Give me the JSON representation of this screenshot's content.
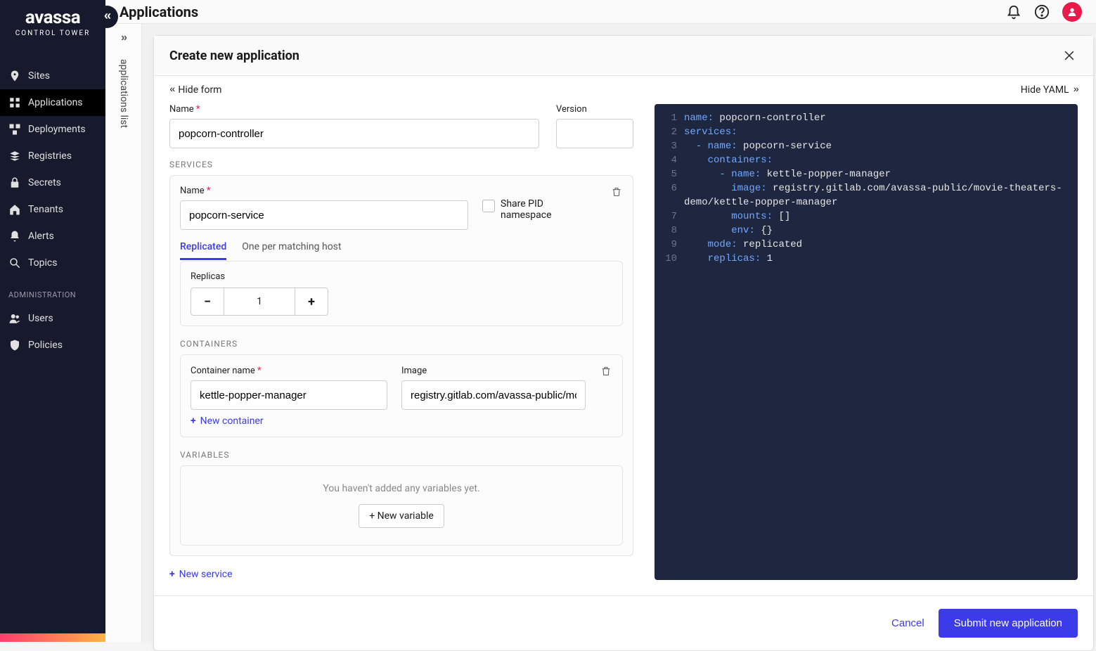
{
  "brand": {
    "name": "avassa",
    "subtitle": "CONTROL TOWER"
  },
  "page_title": "Applications",
  "sidebar": {
    "items": [
      {
        "label": "Sites",
        "icon": "pin"
      },
      {
        "label": "Applications",
        "icon": "grid",
        "active": true
      },
      {
        "label": "Deployments",
        "icon": "boxes"
      },
      {
        "label": "Registries",
        "icon": "stack"
      },
      {
        "label": "Secrets",
        "icon": "lock"
      },
      {
        "label": "Tenants",
        "icon": "house"
      },
      {
        "label": "Alerts",
        "icon": "bell"
      },
      {
        "label": "Topics",
        "icon": "search"
      }
    ],
    "admin_label": "ADMINISTRATION",
    "admin_items": [
      {
        "label": "Users",
        "icon": "users"
      },
      {
        "label": "Policies",
        "icon": "shield"
      }
    ]
  },
  "sec_bar": {
    "label": "applications list"
  },
  "modal": {
    "title": "Create new application",
    "hide_form": "Hide form",
    "hide_yaml": "Hide YAML",
    "form": {
      "name_label": "Name",
      "name_value": "popcorn-controller",
      "version_label": "Version",
      "version_value": "",
      "services_label": "SERVICES",
      "service": {
        "name_label": "Name",
        "name_value": "popcorn-service",
        "share_pid_label": "Share PID namespace",
        "tab_replicated": "Replicated",
        "tab_one_per": "One per matching host",
        "replicas_label": "Replicas",
        "replicas_value": "1",
        "containers_label": "CONTAINERS",
        "container_name_label": "Container name",
        "container_name_value": "kettle-popper-manager",
        "image_label": "Image",
        "image_value": "registry.gitlab.com/avassa-public/movie-",
        "new_container": "New container",
        "variables_label": "VARIABLES",
        "variables_empty": "You haven't added any variables yet.",
        "new_variable": "+ New variable"
      },
      "new_service": "New service"
    },
    "footer": {
      "cancel": "Cancel",
      "submit": "Submit new application"
    },
    "yaml": [
      [
        {
          "t": "k",
          "v": "name"
        },
        {
          "t": "p",
          "v": ": "
        },
        {
          "t": "v",
          "v": "popcorn-controller"
        }
      ],
      [
        {
          "t": "k",
          "v": "services"
        },
        {
          "t": "p",
          "v": ":"
        }
      ],
      [
        {
          "t": "v",
          "v": "  "
        },
        {
          "t": "d",
          "v": "- "
        },
        {
          "t": "k",
          "v": "name"
        },
        {
          "t": "p",
          "v": ": "
        },
        {
          "t": "v",
          "v": "popcorn-service"
        }
      ],
      [
        {
          "t": "v",
          "v": "    "
        },
        {
          "t": "k",
          "v": "containers"
        },
        {
          "t": "p",
          "v": ":"
        }
      ],
      [
        {
          "t": "v",
          "v": "      "
        },
        {
          "t": "d",
          "v": "- "
        },
        {
          "t": "k",
          "v": "name"
        },
        {
          "t": "p",
          "v": ": "
        },
        {
          "t": "v",
          "v": "kettle-popper-manager"
        }
      ],
      [
        {
          "t": "v",
          "v": "        "
        },
        {
          "t": "k",
          "v": "image"
        },
        {
          "t": "p",
          "v": ": "
        },
        {
          "t": "v",
          "v": "registry.gitlab.com/avassa-public/movie-theaters-"
        }
      ],
      [
        {
          "t": "v",
          "v": "demo/kettle-popper-manager"
        }
      ],
      [
        {
          "t": "v",
          "v": "        "
        },
        {
          "t": "k",
          "v": "mounts"
        },
        {
          "t": "p",
          "v": ": "
        },
        {
          "t": "v",
          "v": "[]"
        }
      ],
      [
        {
          "t": "v",
          "v": "        "
        },
        {
          "t": "k",
          "v": "env"
        },
        {
          "t": "p",
          "v": ": "
        },
        {
          "t": "v",
          "v": "{}"
        }
      ],
      [
        {
          "t": "v",
          "v": "    "
        },
        {
          "t": "k",
          "v": "mode"
        },
        {
          "t": "p",
          "v": ": "
        },
        {
          "t": "v",
          "v": "replicated"
        }
      ],
      [
        {
          "t": "v",
          "v": "    "
        },
        {
          "t": "k",
          "v": "replicas"
        },
        {
          "t": "p",
          "v": ": "
        },
        {
          "t": "v",
          "v": "1"
        }
      ]
    ],
    "yaml_line_numbers": [
      "1",
      "2",
      "3",
      "4",
      "5",
      "6",
      "",
      "7",
      "8",
      "9",
      "10"
    ]
  }
}
